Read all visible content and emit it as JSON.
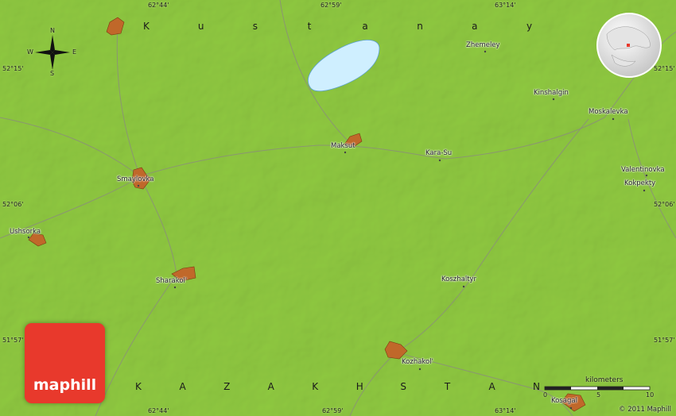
{
  "map": {
    "region_top": "Kustanay",
    "region_bottom": "KAZAKHSTAN",
    "colors": {
      "land": "#a9d95a",
      "lake": "#cfefff",
      "town": "#c0682a",
      "logo": "#e8392c"
    },
    "lon_labels": [
      "62°44'",
      "62°59'",
      "63°14'"
    ],
    "lat_labels": [
      "52°15'",
      "52°06'",
      "51°57'"
    ],
    "places": [
      {
        "name": "Zhemeley"
      },
      {
        "name": "Kinshalgin"
      },
      {
        "name": "Moskalevka"
      },
      {
        "name": "Maksut"
      },
      {
        "name": "Kara-Su"
      },
      {
        "name": "Smaylovka"
      },
      {
        "name": "Valentinovka"
      },
      {
        "name": "Kokpekty"
      },
      {
        "name": "Ushsorka"
      },
      {
        "name": "Sharakol'"
      },
      {
        "name": "Koszhaltyr"
      },
      {
        "name": "Kozhakol'"
      },
      {
        "name": "Kosagal"
      }
    ],
    "compass": {
      "n": "N",
      "s": "S",
      "e": "E",
      "w": "W"
    },
    "scale": {
      "unit": "kilometers",
      "ticks": [
        "0",
        "5",
        "10"
      ]
    },
    "logo": "maphill",
    "copyright": "© 2011 Maphill"
  }
}
